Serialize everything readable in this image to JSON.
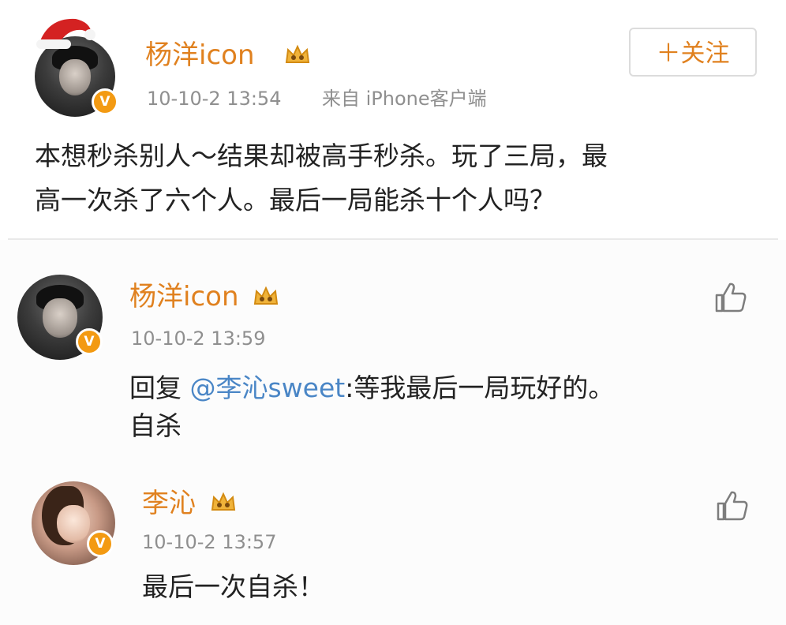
{
  "post": {
    "author": "杨洋icon",
    "time": "10-10-2 13:54",
    "source": "来自 iPhone客户端",
    "follow_label": "＋关注",
    "text_line1": "本想秒杀别人～结果却被高手秒杀。玩了三局，最",
    "text_line2": "高一次杀了六个人。最后一局能杀十个人吗？"
  },
  "comments": [
    {
      "author": "杨洋icon",
      "time": "10-10-2 13:59",
      "reply_prefix": "回复 ",
      "mention": "@李沁sweet",
      "text_rest": ":等我最后一局玩好的。",
      "text_line2": "自杀"
    },
    {
      "author": "李沁",
      "time": "10-10-2 13:57",
      "text": "最后一次自杀！"
    }
  ],
  "icons": {
    "verified_badge": "V",
    "crown": "crown-icon",
    "like": "thumbs-up-icon",
    "santa_hat": "santa-hat-icon"
  },
  "colors": {
    "name": "#e0811f",
    "mention": "#4a86c6",
    "meta": "#8f8f8f",
    "badge": "#f39a12"
  }
}
